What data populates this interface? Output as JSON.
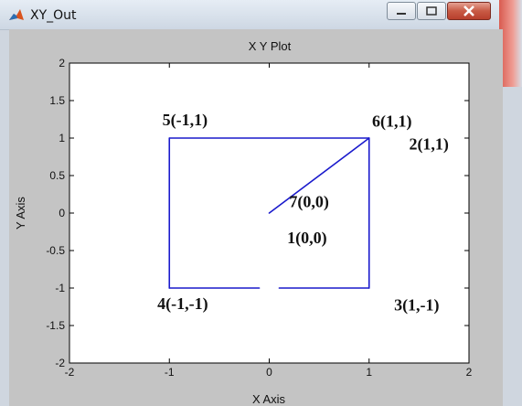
{
  "window": {
    "title": "XY_Out",
    "colors": {
      "titlebar": "#dfe7f0",
      "close_button": "#c85a45",
      "figure_bg": "#c4c4c4"
    }
  },
  "chart_data": {
    "type": "line",
    "title": "X Y Plot",
    "xlabel": "X Axis",
    "ylabel": "Y Axis",
    "xlim": [
      -2,
      2
    ],
    "ylim": [
      -2,
      2
    ],
    "x_ticks": [
      -2,
      -1,
      0,
      1,
      2
    ],
    "y_ticks": [
      -2,
      -1.5,
      -1,
      -0.5,
      0,
      0.5,
      1,
      1.5,
      2
    ],
    "x_tick_labels": [
      "-2",
      "-1",
      "0",
      "1",
      "2"
    ],
    "y_tick_labels": [
      "-2",
      "-1.5",
      "-1",
      "-0.5",
      "0",
      "0.5",
      "1",
      "1.5",
      "2"
    ],
    "grid": false,
    "series": [
      {
        "color": "#1a1acc",
        "points": [
          [
            0,
            0
          ],
          [
            1,
            1
          ],
          [
            -1,
            1
          ],
          [
            -1,
            -1
          ],
          [
            -0.1,
            -1
          ],
          [
            0.1,
            -1
          ],
          [
            1,
            -1
          ],
          [
            1,
            1
          ]
        ]
      }
    ],
    "annotations": [
      {
        "text": "1(0,0)",
        "x": 0.18,
        "y": -0.4
      },
      {
        "text": "2(1,1)",
        "x": 1.4,
        "y": 0.85
      },
      {
        "text": "3(1,-1)",
        "x": 1.25,
        "y": -1.3
      },
      {
        "text": "4(-1,-1)",
        "x": -1.12,
        "y": -1.28
      },
      {
        "text": "5(-1,1)",
        "x": -1.07,
        "y": 1.17
      },
      {
        "text": "6(1,1)",
        "x": 1.03,
        "y": 1.15
      },
      {
        "text": "7(0,0)",
        "x": 0.2,
        "y": 0.08
      }
    ]
  }
}
